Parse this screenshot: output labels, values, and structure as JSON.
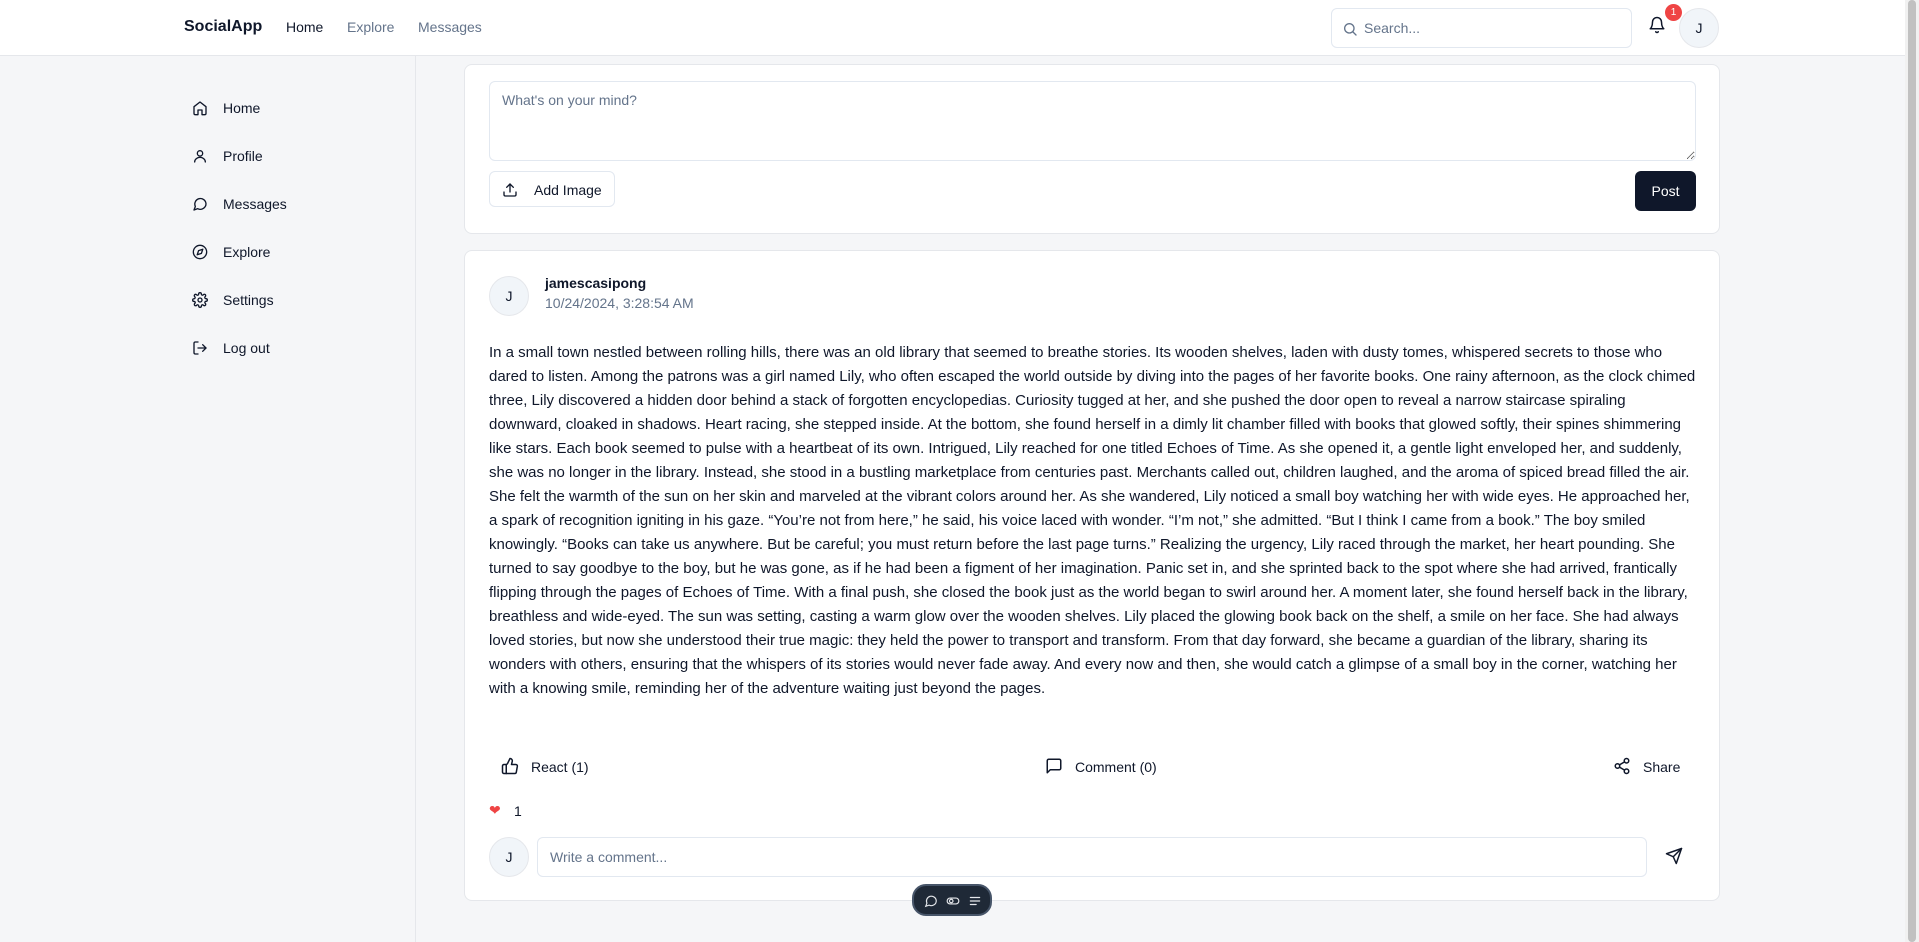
{
  "header": {
    "brand": "SocialApp",
    "nav": [
      {
        "label": "Home"
      },
      {
        "label": "Explore"
      },
      {
        "label": "Messages"
      }
    ],
    "search_placeholder": "Search...",
    "notification_count": "1",
    "avatar_initial": "J",
    "icons": {
      "search": "search-icon",
      "bell": "bell-icon"
    }
  },
  "sidebar": {
    "items": [
      {
        "label": "Home",
        "icon": "home-icon"
      },
      {
        "label": "Profile",
        "icon": "user-icon"
      },
      {
        "label": "Messages",
        "icon": "message-circle-icon"
      },
      {
        "label": "Explore",
        "icon": "compass-icon"
      },
      {
        "label": "Settings",
        "icon": "gear-icon"
      },
      {
        "label": "Log out",
        "icon": "log-out-icon"
      }
    ]
  },
  "composer": {
    "placeholder": "What's on your mind?",
    "add_image_label": "Add Image",
    "post_label": "Post"
  },
  "post": {
    "avatar_initial": "J",
    "author": "jamescasipong",
    "timestamp": "10/24/2024, 3:28:54 AM",
    "body": "In a small town nestled between rolling hills, there was an old library that seemed to breathe stories. Its wooden shelves, laden with dusty tomes, whispered secrets to those who dared to listen. Among the patrons was a girl named Lily, who often escaped the world outside by diving into the pages of her favorite books. One rainy afternoon, as the clock chimed three, Lily discovered a hidden door behind a stack of forgotten encyclopedias. Curiosity tugged at her, and she pushed the door open to reveal a narrow staircase spiraling downward, cloaked in shadows. Heart racing, she stepped inside. At the bottom, she found herself in a dimly lit chamber filled with books that glowed softly, their spines shimmering like stars. Each book seemed to pulse with a heartbeat of its own. Intrigued, Lily reached for one titled Echoes of Time. As she opened it, a gentle light enveloped her, and suddenly, she was no longer in the library. Instead, she stood in a bustling marketplace from centuries past. Merchants called out, children laughed, and the aroma of spiced bread filled the air. She felt the warmth of the sun on her skin and marveled at the vibrant colors around her. As she wandered, Lily noticed a small boy watching her with wide eyes. He approached her, a spark of recognition igniting in his gaze. “You’re not from here,” he said, his voice laced with wonder. “I’m not,” she admitted. “But I think I came from a book.” The boy smiled knowingly. “Books can take us anywhere. But be careful; you must return before the last page turns.” Realizing the urgency, Lily raced through the market, her heart pounding. She turned to say goodbye to the boy, but he was gone, as if he had been a figment of her imagination. Panic set in, and she sprinted back to the spot where she had arrived, frantically flipping through the pages of Echoes of Time. With a final push, she closed the book just as the world began to swirl around her. A moment later, she found herself back in the library, breathless and wide-eyed. The sun was setting, casting a warm glow over the wooden shelves. Lily placed the glowing book back on the shelf, a smile on her face. She had always loved stories, but now she understood their true magic: they held the power to transport and transform. From that day forward, she became a guardian of the library, sharing its wonders with others, ensuring that the whispers of its stories would never fade away. And every now and then, she would catch a glimpse of a small boy in the corner, watching her with a knowing smile, reminding her of the adventure waiting just beyond the pages.",
    "react_label": "React (1)",
    "comment_label": "Comment (0)",
    "share_label": "Share",
    "reaction_count": "1",
    "comment_placeholder": "Write a comment...",
    "comment_avatar_initial": "J"
  },
  "colors": {
    "primary": "#0f172a",
    "muted": "#64748b",
    "badge": "#ef4444",
    "background": "#f5f6f8"
  }
}
